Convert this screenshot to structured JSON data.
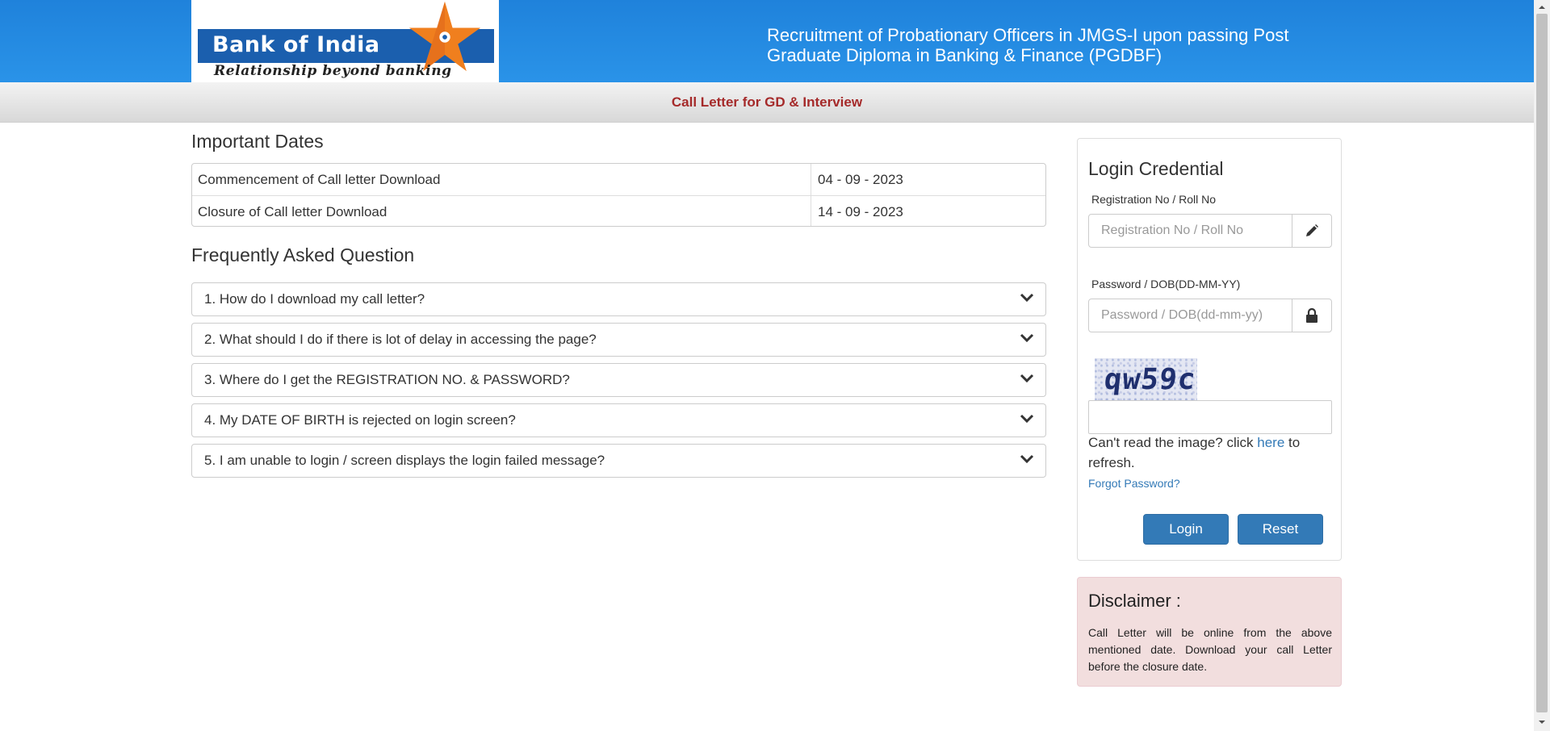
{
  "header": {
    "logo": {
      "name": "Bank of India",
      "tagline": "Relationship beyond banking"
    },
    "title": "Recruitment of Probationary Officers in JMGS-I upon passing Post Graduate Diploma in Banking & Finance (PGDBF)"
  },
  "subheader": {
    "title": "Call Letter for GD & Interview"
  },
  "important_dates": {
    "heading": "Important Dates",
    "rows": [
      {
        "label": "Commencement of Call letter Download",
        "value": "04 - 09 - 2023"
      },
      {
        "label": "Closure of Call letter Download",
        "value": "14 - 09 - 2023"
      }
    ]
  },
  "faq": {
    "heading": "Frequently Asked Question",
    "items": [
      "1. How do I download my call letter?",
      "2. What should I do if there is lot of delay in accessing the page?",
      "3. Where do I get the REGISTRATION NO. & PASSWORD?",
      "4. My DATE OF BIRTH is rejected on login screen?",
      "5. I am unable to login / screen displays the login failed message?"
    ]
  },
  "login": {
    "title": "Login Credential",
    "registration": {
      "label": "Registration No / Roll No",
      "placeholder": "Registration No / Roll No",
      "value": "",
      "icon": "pencil-icon"
    },
    "password": {
      "label": "Password / DOB(DD-MM-YY)",
      "placeholder": "Password / DOB(dd-mm-yy)",
      "value": "",
      "icon": "lock-icon"
    },
    "captcha": {
      "text": "qw59c",
      "input_value": ""
    },
    "refresh_note": {
      "before": "Can't read the image? click ",
      "link": "here",
      "after": " to refresh."
    },
    "forgot_password": "Forgot Password?",
    "login_button": "Login",
    "reset_button": "Reset"
  },
  "disclaimer": {
    "title": "Disclaimer :",
    "text": "Call Letter will be online from the above mentioned date. Download your call Letter before the closure date."
  },
  "colors": {
    "header_blue": "#1f82db",
    "subheader_title": "#a52a2a",
    "button_primary": "#337ab7",
    "link": "#337ab7",
    "disclaimer_bg": "#f2dede"
  }
}
